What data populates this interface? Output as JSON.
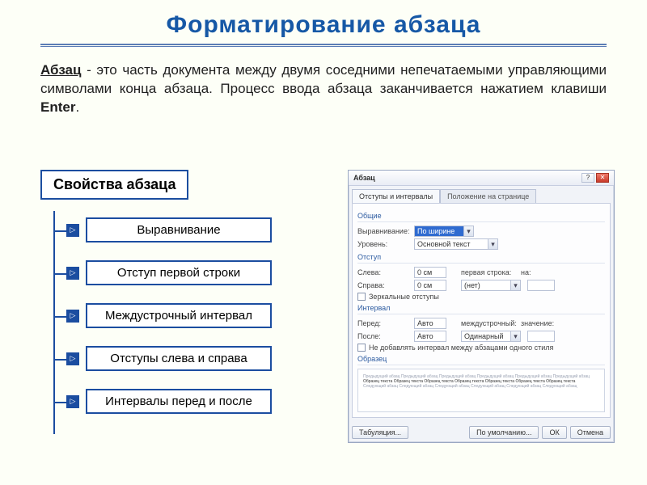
{
  "title": "Форматирование абзаца",
  "definition": {
    "term": "Абзац",
    "body": " - это часть документа между двумя соседними непечатаемыми управляющими символами конца абзаца. Процесс ввода абзаца заканчивается нажатием клавиши ",
    "key": "Enter",
    "tail": "."
  },
  "props": {
    "heading": "Свойства абзаца",
    "items": [
      "Выравнивание",
      "Отступ первой строки",
      "Междустрочный интервал",
      "Отступы слева и справа",
      "Интервалы перед и после"
    ]
  },
  "dialog": {
    "title": "Абзац",
    "tabs": {
      "active": "Отступы и интервалы",
      "inactive": "Положение на странице"
    },
    "groups": {
      "general": {
        "label": "Общие",
        "align_label": "Выравнивание:",
        "align_value": "По ширине",
        "level_label": "Уровень:",
        "level_value": "Основной текст"
      },
      "indent": {
        "label": "Отступ",
        "left_label": "Слева:",
        "left_value": "0 см",
        "right_label": "Справа:",
        "right_value": "0 см",
        "first_label": "первая строка:",
        "first_value": "(нет)",
        "by_label": "на:",
        "by_value": "",
        "mirror": "Зеркальные отступы"
      },
      "spacing": {
        "label": "Интервал",
        "before_label": "Перед:",
        "before_value": "Авто",
        "after_label": "После:",
        "after_value": "Авто",
        "line_label": "междустрочный:",
        "line_value": "Одинарный",
        "val_label": "значение:",
        "val_value": "",
        "no_add": "Не добавлять интервал между абзацами одного стиля"
      },
      "preview": {
        "label": "Образец",
        "sample1": "Предыдущий абзац Предыдущий абзац Предыдущий абзац Предыдущий абзац Предыдущий абзац Предыдущий абзац",
        "sample2": "Образец текста Образец текста Образец текста Образец текста Образец текста Образец текста Образец текста",
        "sample3": "Следующий абзац Следующий абзац Следующий абзац Следующий абзац Следующий абзац Следующий абзац"
      }
    },
    "buttons": {
      "tabs": "Табуляция...",
      "default": "По умолчанию...",
      "ok": "ОК",
      "cancel": "Отмена"
    }
  }
}
